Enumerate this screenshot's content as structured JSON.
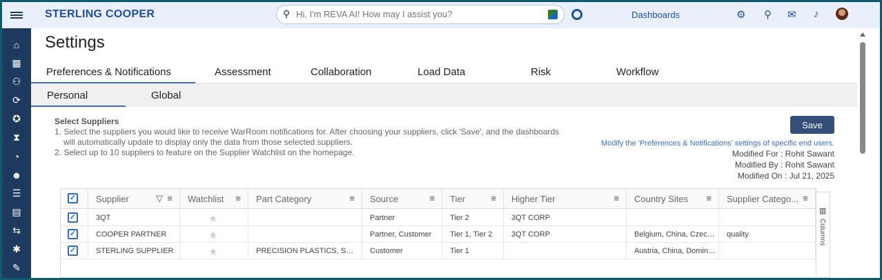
{
  "header": {
    "brand": "STERLING COOPER",
    "search_placeholder": "Hi, I'm REVA AI! How may I assist you?",
    "dashboards_label": "Dashboards"
  },
  "page": {
    "title": "Settings"
  },
  "tabs_primary": [
    {
      "label": "Preferences & Notifications",
      "active": true
    },
    {
      "label": "Assessment"
    },
    {
      "label": "Collaboration"
    },
    {
      "label": "Load Data"
    },
    {
      "label": "Risk"
    },
    {
      "label": "Workflow"
    }
  ],
  "tabs_secondary": [
    {
      "label": "Personal",
      "active": true
    },
    {
      "label": "Global"
    }
  ],
  "select_suppliers": {
    "heading": "Select Suppliers",
    "line1": "1. Select the suppliers you would like to receive WarRoom notifications for. After choosing your suppliers, click 'Save', and the dashboards",
    "line1b": "will automatically update to display only the data from those selected suppliers.",
    "line2": "2. Select up to 10 suppliers to feature on the Supplier Watchlist on the homepage."
  },
  "actions": {
    "save_label": "Save",
    "modify_link": "Modify the 'Preferences & Notifications' settings of specific end users.",
    "modified_for": "Modified For :  Rohit Sawant",
    "modified_by": "Modified By :  Rohit Sawant",
    "modified_on": "Modified On :  Jul 21, 2025"
  },
  "grid": {
    "columns": [
      "Supplier",
      "Watchlist",
      "Part Category",
      "Source",
      "Tier",
      "Higher Tier",
      "Country Sites",
      "Supplier Catego..."
    ],
    "rows": [
      {
        "checked": true,
        "supplier": "3QT",
        "part_category": "",
        "source": "Partner",
        "tier": "Tier 2",
        "higher_tier": "3QT CORP",
        "country_sites": "",
        "supplier_category": ""
      },
      {
        "checked": true,
        "supplier": "COOPER PARTNER",
        "part_category": "",
        "source": "Partner, Customer",
        "tier": "Tier 1, Tier 2",
        "higher_tier": "3QT CORP",
        "country_sites": "Belgium, China, Czechi...",
        "supplier_category": "quality"
      },
      {
        "checked": true,
        "supplier": "STERLING SUPPLIER",
        "part_category": "PRECISION PLASTICS, SUPP...",
        "source": "Customer",
        "tier": "Tier 1",
        "higher_tier": "",
        "country_sites": "Austria, China, Domini...",
        "supplier_category": ""
      }
    ],
    "columns_panel_label": "Columns"
  },
  "colors": {
    "brand": "#1f4e9c",
    "rail": "#1f3a5f",
    "accent": "#3a6fc4",
    "save_bg": "#344f7a"
  },
  "rail_icons": [
    "home-icon",
    "calendar-icon",
    "org-chart-icon",
    "refresh-icon",
    "award-icon",
    "hourglass-icon",
    "gauge-icon",
    "user-settings-icon",
    "list-icon",
    "clipboard-icon",
    "transfer-icon",
    "new-badge-icon",
    "edit-user-icon"
  ]
}
